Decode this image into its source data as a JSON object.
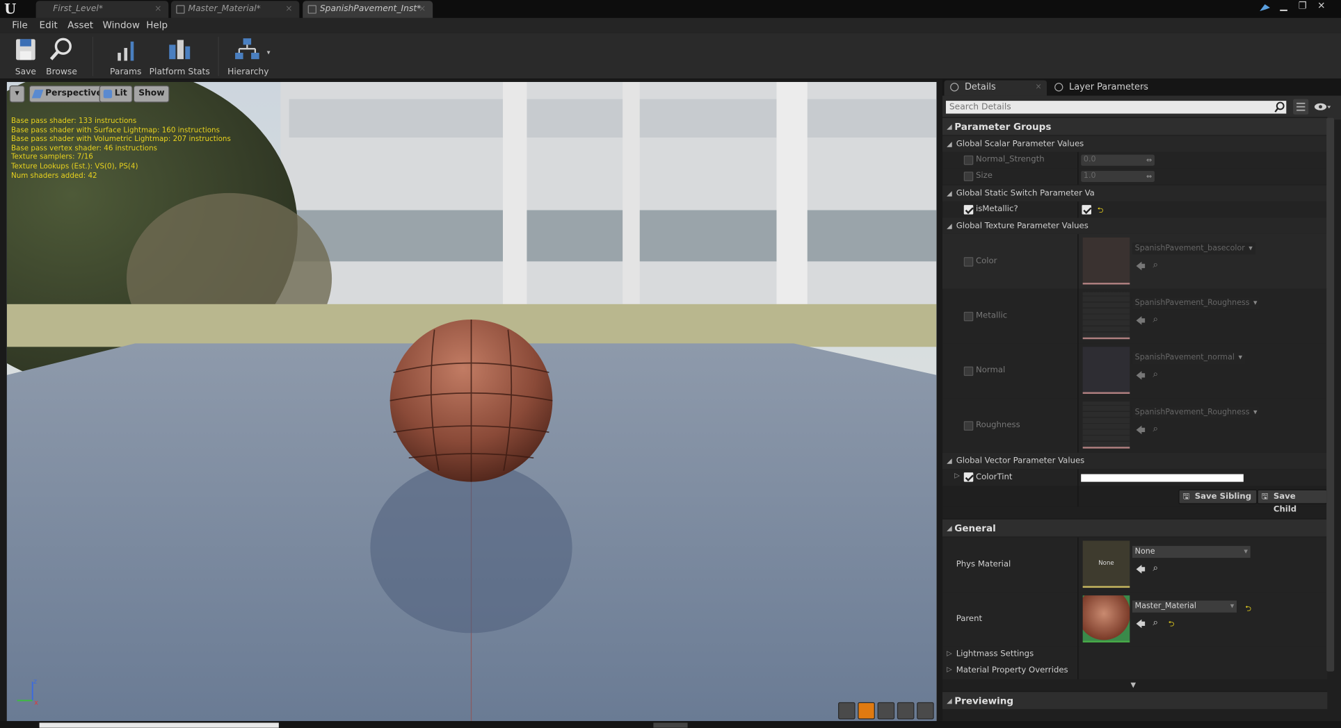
{
  "tabs": [
    {
      "label": "First_Level*",
      "active": false
    },
    {
      "label": "Master_Material*",
      "active": false
    },
    {
      "label": "SpanishPavement_Inst*",
      "active": true
    }
  ],
  "menu": [
    "File",
    "Edit",
    "Asset",
    "Window",
    "Help"
  ],
  "toolbar": {
    "save": "Save",
    "browse": "Browse",
    "params": "Params",
    "platform_stats": "Platform Stats",
    "hierarchy": "Hierarchy"
  },
  "viewport": {
    "buttons": {
      "perspective": "Perspective",
      "lit": "Lit",
      "show": "Show"
    },
    "stats": [
      "Base pass shader: 133 instructions",
      "Base pass shader with Surface Lightmap: 160 instructions",
      "Base pass shader with Volumetric Lightmap: 207 instructions",
      "Base pass vertex shader: 46 instructions",
      "Texture samplers: 7/16",
      "Texture Lookups (Est.): VS(0), PS(4)",
      "Num shaders added: 42"
    ],
    "stats_color": "#e8d21e"
  },
  "details": {
    "tabs": [
      "Details",
      "Layer Parameters"
    ],
    "search_placeholder": "Search Details",
    "parameter_groups": {
      "title": "Parameter Groups",
      "scalar": {
        "title": "Global Scalar Parameter Values",
        "params": [
          {
            "name": "Normal_Strength",
            "value": "0.0",
            "enabled": false
          },
          {
            "name": "Size",
            "value": "1.0",
            "enabled": false
          }
        ]
      },
      "static_switch": {
        "title": "Global Static Switch Parameter Va",
        "params": [
          {
            "name": "isMetallic?",
            "enabled": true,
            "value": true
          }
        ]
      },
      "texture": {
        "title": "Global Texture Parameter Values",
        "params": [
          {
            "name": "Color",
            "texture": "SpanishPavement_basecolor",
            "enabled": false
          },
          {
            "name": "Metallic",
            "texture": "SpanishPavement_Roughness",
            "enabled": false
          },
          {
            "name": "Normal",
            "texture": "SpanishPavement_normal",
            "enabled": false
          },
          {
            "name": "Roughness",
            "texture": "SpanishPavement_Roughness",
            "enabled": false
          }
        ]
      },
      "vector": {
        "title": "Global Vector Parameter Values",
        "params": [
          {
            "name": "ColorTint",
            "enabled": true,
            "color": "#ffffff"
          }
        ]
      },
      "save_sibling": "Save Sibling",
      "save_child": "Save Child"
    },
    "general": {
      "title": "General",
      "phys_material": {
        "label": "Phys Material",
        "thumb_text": "None",
        "value": "None"
      },
      "parent": {
        "label": "Parent",
        "value": "Master_Material"
      },
      "lightmass": "Lightmass Settings",
      "overrides": "Material Property Overrides"
    },
    "previewing": "Previewing"
  }
}
